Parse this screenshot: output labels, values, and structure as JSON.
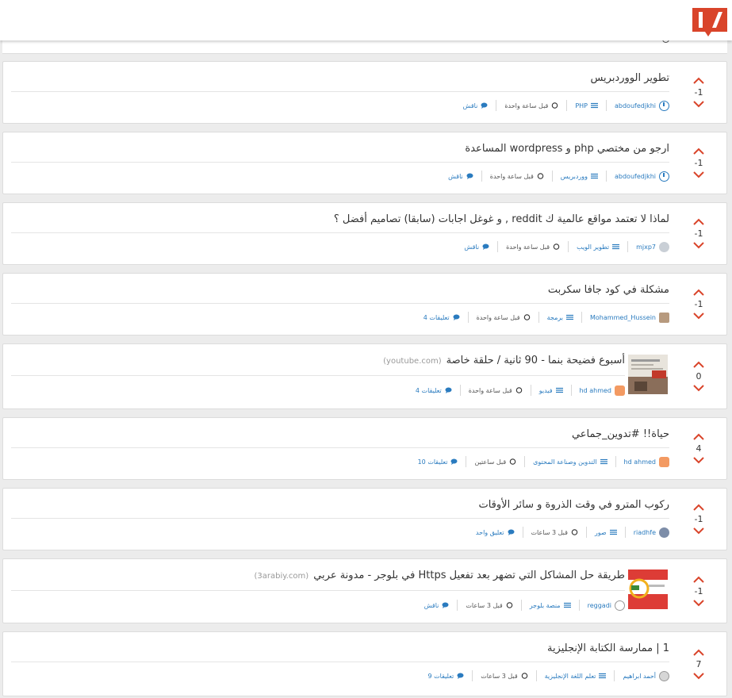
{
  "brand": {
    "logo_text": "I/O",
    "accent": "#d9442a"
  },
  "posts": [
    {
      "score": "-1",
      "title": "تطوير الووردبريس",
      "domain": "",
      "thumb": "",
      "author": "abdoufedjkhi",
      "avatar": "blue",
      "category": "PHP",
      "time": "قبل ساعة واحدة",
      "comments": "ناقش"
    },
    {
      "score": "-1",
      "title": "ارجو من مختصي php و wordpress المساعدة",
      "domain": "",
      "thumb": "",
      "author": "abdoufedjkhi",
      "avatar": "blue",
      "category": "ووردبريس",
      "time": "قبل ساعة واحدة",
      "comments": "ناقش"
    },
    {
      "score": "-1",
      "title": "لماذا لا تعتمد مواقع عالمية ك reddit , و غوغل اجابات (سابقا) تصاميم أفضل ؟",
      "domain": "",
      "thumb": "",
      "author": "mjxp7",
      "avatar": "grey",
      "category": "تطوير الويب",
      "time": "قبل ساعة واحدة",
      "comments": "ناقش"
    },
    {
      "score": "-1",
      "title": "مشكلة في كود جافا سكربت",
      "domain": "",
      "thumb": "",
      "author": "Mohammed_Hussein",
      "avatar": "user",
      "category": "برمجة",
      "time": "قبل ساعة واحدة",
      "comments": "4 تعليقات"
    },
    {
      "score": "0",
      "title": "أسبوع فضيحة بنما - 90 ثانية / حلقة خاصة",
      "domain": "(youtube.com)",
      "thumb": "newspaper",
      "author": "hd ahmed",
      "avatar": "orange",
      "category": "فيديو",
      "time": "قبل ساعة واحدة",
      "comments": "4 تعليقات"
    },
    {
      "score": "4",
      "title": "حياة!! #تدوين_جماعي",
      "domain": "",
      "thumb": "",
      "author": "hd ahmed",
      "avatar": "orange",
      "category": "التدوين وصناعة المحتوى",
      "time": "قبل ساعتين",
      "comments": "10 تعليقات"
    },
    {
      "score": "-1",
      "title": "ركوب المترو في وقت الذروة و سائر الأوقات",
      "domain": "",
      "thumb": "",
      "author": "riadhfe",
      "avatar": "photo",
      "category": "صور",
      "time": "قبل 3 ساعات",
      "comments": "تعليق واحد"
    },
    {
      "score": "-1",
      "title": "طريقة حل المشاكل التي تضهر بعد تفعيل Https في بلوجر - مدونة عربي",
      "domain": "(3arabiy.com)",
      "thumb": "https",
      "author": "reggadi",
      "avatar": "line",
      "category": "منصة بلوجر",
      "time": "قبل 3 ساعات",
      "comments": "ناقش"
    },
    {
      "score": "7",
      "title": "1 | ممارسة الكتابة الإنجليزية",
      "domain": "",
      "thumb": "",
      "author": "أحمد ابراهيم",
      "avatar": "mixed",
      "category": "تعلم اللغة الإنجليزية",
      "time": "قبل 3 ساعات",
      "comments": "9 تعليقات"
    }
  ]
}
